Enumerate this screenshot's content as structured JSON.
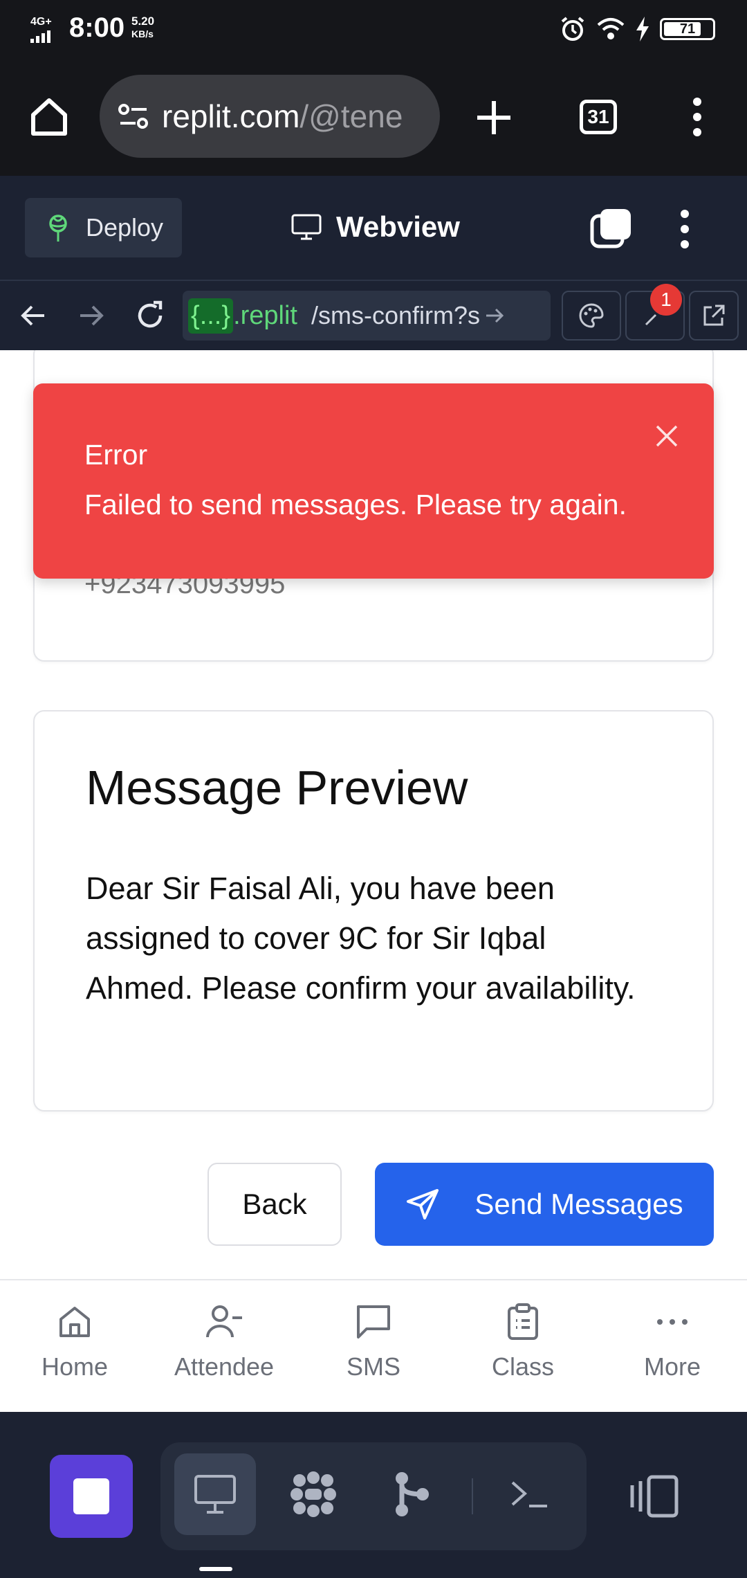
{
  "status_bar": {
    "network": "4G+",
    "time": "8:00",
    "speed_value": "5.20",
    "speed_unit": "KB/s",
    "battery": "71"
  },
  "browser": {
    "url_main": "replit.com",
    "url_rest": "/@tene",
    "tabs_count": "31"
  },
  "replit_header": {
    "deploy_label": "Deploy",
    "webview_label": "Webview"
  },
  "nav": {
    "repl_tag": "{...}",
    "domain": ".replit",
    "path": "/sms-confirm?s",
    "notification_count": "1"
  },
  "toast": {
    "title": "Error",
    "message": "Failed to send messages. Please try again."
  },
  "recipient_card": {
    "phone": "+923473093995"
  },
  "preview_card": {
    "title": "Message Preview",
    "body": "Dear Sir Faisal Ali, you have been assigned to cover 9C for Sir Iqbal Ahmed. Please confirm your availability."
  },
  "actions": {
    "back_label": "Back",
    "send_label": "Send Messages"
  },
  "tabbar": {
    "items": [
      {
        "label": "Home",
        "icon": "home-icon"
      },
      {
        "label": "Attendee",
        "icon": "user-minus-icon"
      },
      {
        "label": "SMS",
        "icon": "message-square-icon"
      },
      {
        "label": "Class",
        "icon": "clipboard-icon"
      },
      {
        "label": "More",
        "icon": "more-horizontal-icon"
      }
    ]
  },
  "colors": {
    "toast_bg": "#ef4444",
    "primary_button": "#2563eb",
    "replit_bg": "#1c2232",
    "stop_button": "#5b3fd9"
  }
}
